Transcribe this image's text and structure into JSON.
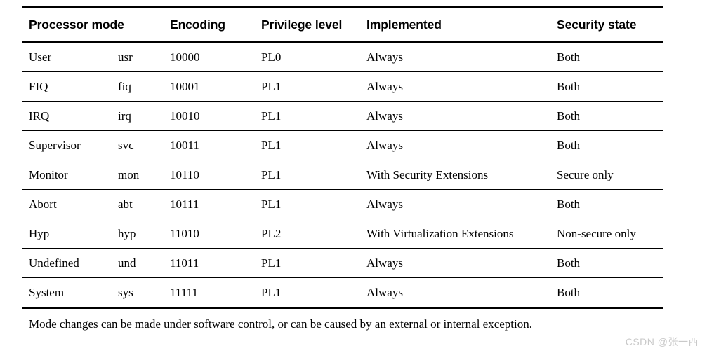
{
  "document": {
    "background_color": "#ffffff",
    "text_color": "#000000",
    "rule_color": "#000000"
  },
  "table": {
    "columns": [
      {
        "key": "mode",
        "label": "Processor mode"
      },
      {
        "key": "abbr",
        "label": ""
      },
      {
        "key": "encoding",
        "label": "Encoding"
      },
      {
        "key": "privilege",
        "label": "Privilege level"
      },
      {
        "key": "implemented",
        "label": "Implemented"
      },
      {
        "key": "security",
        "label": "Security state"
      }
    ],
    "rows": [
      {
        "mode": "User",
        "abbr": "usr",
        "encoding": "10000",
        "privilege": "PL0",
        "implemented": "Always",
        "security": "Both"
      },
      {
        "mode": "FIQ",
        "abbr": "fiq",
        "encoding": "10001",
        "privilege": "PL1",
        "implemented": "Always",
        "security": "Both"
      },
      {
        "mode": "IRQ",
        "abbr": "irq",
        "encoding": "10010",
        "privilege": "PL1",
        "implemented": "Always",
        "security": "Both"
      },
      {
        "mode": "Supervisor",
        "abbr": "svc",
        "encoding": "10011",
        "privilege": "PL1",
        "implemented": "Always",
        "security": "Both"
      },
      {
        "mode": "Monitor",
        "abbr": "mon",
        "encoding": "10110",
        "privilege": "PL1",
        "implemented": "With Security Extensions",
        "security": "Secure only"
      },
      {
        "mode": "Abort",
        "abbr": "abt",
        "encoding": "10111",
        "privilege": "PL1",
        "implemented": "Always",
        "security": "Both"
      },
      {
        "mode": "Hyp",
        "abbr": "hyp",
        "encoding": "11010",
        "privilege": "PL2",
        "implemented": "With Virtualization Extensions",
        "security": "Non-secure only"
      },
      {
        "mode": "Undefined",
        "abbr": "und",
        "encoding": "11011",
        "privilege": "PL1",
        "implemented": "Always",
        "security": "Both"
      },
      {
        "mode": "System",
        "abbr": "sys",
        "encoding": "11111",
        "privilege": "PL1",
        "implemented": "Always",
        "security": "Both"
      }
    ]
  },
  "caption": {
    "text": "Mode changes can be made under software control, or can be caused by an external or internal exception."
  },
  "watermark": {
    "text": "CSDN @张一西"
  }
}
